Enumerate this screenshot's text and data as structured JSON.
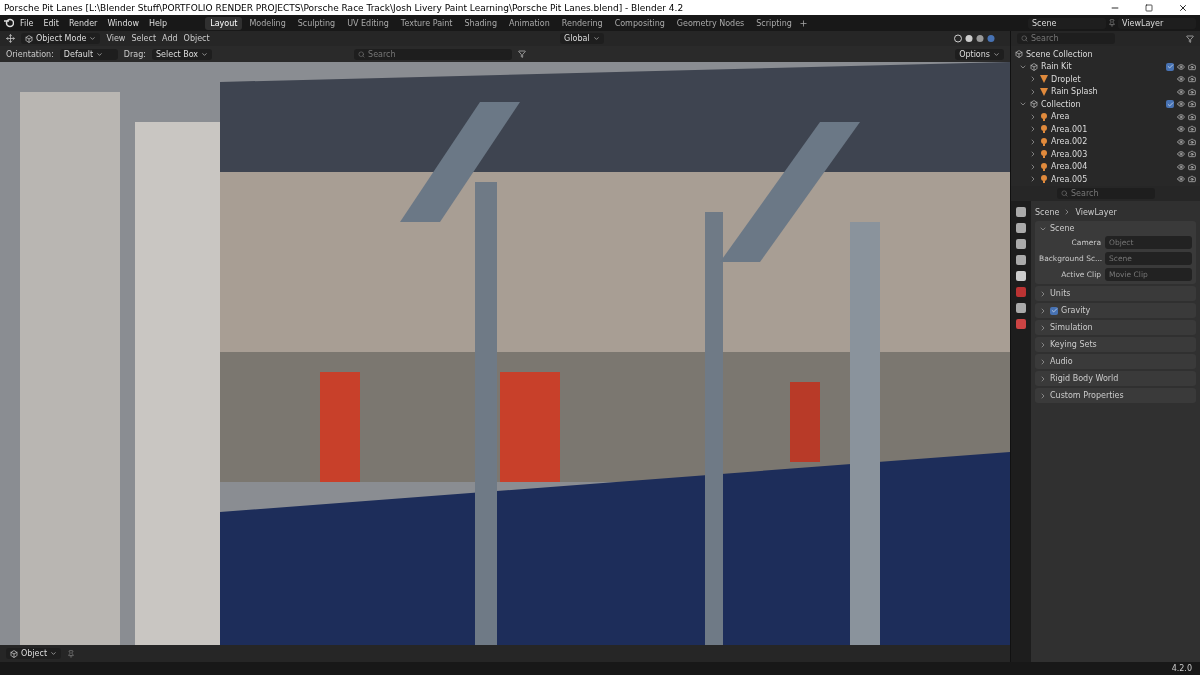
{
  "window": {
    "title": "Porsche Pit Lanes [L:\\Blender Stuff\\PORTFOLIO RENDER PROJECTS\\Porsche Race Track\\Josh Livery Paint Learning\\Porsche Pit Lanes.blend] - Blender 4.2"
  },
  "menu": [
    "File",
    "Edit",
    "Render",
    "Window",
    "Help"
  ],
  "workspaces": [
    {
      "label": "Layout",
      "selected": true
    },
    {
      "label": "Modeling",
      "selected": false
    },
    {
      "label": "Sculpting",
      "selected": false
    },
    {
      "label": "UV Editing",
      "selected": false
    },
    {
      "label": "Texture Paint",
      "selected": false
    },
    {
      "label": "Shading",
      "selected": false
    },
    {
      "label": "Animation",
      "selected": false
    },
    {
      "label": "Rendering",
      "selected": false
    },
    {
      "label": "Compositing",
      "selected": false
    },
    {
      "label": "Geometry Nodes",
      "selected": false
    },
    {
      "label": "Scripting",
      "selected": false
    }
  ],
  "scene": "Scene",
  "view_layer": "ViewLayer",
  "viewport_header": {
    "mode": "Object Mode",
    "menus": [
      "View",
      "Select",
      "Add",
      "Object"
    ],
    "transform": "Global"
  },
  "tool_header": {
    "orientation_label": "Orientation:",
    "orientation": "Default",
    "drag_label": "Drag:",
    "drag": "Select Box",
    "search_placeholder": "Search",
    "options": "Options"
  },
  "outliner": {
    "search_placeholder": "Search",
    "root": "Scene Collection",
    "items": [
      {
        "label": "Rain Kit",
        "expanded": true,
        "checked": true,
        "children": [
          {
            "label": "Droplet",
            "kind": "object",
            "expanded": false
          },
          {
            "label": "Rain Splash",
            "kind": "object",
            "expanded": false
          }
        ]
      },
      {
        "label": "Collection",
        "expanded": true,
        "checked": true,
        "children": [
          {
            "label": "Area",
            "kind": "light",
            "expanded": false
          },
          {
            "label": "Area.001",
            "kind": "light",
            "expanded": false
          },
          {
            "label": "Area.002",
            "kind": "light",
            "expanded": false
          },
          {
            "label": "Area.003",
            "kind": "light",
            "expanded": false
          },
          {
            "label": "Area.004",
            "kind": "light",
            "expanded": false
          },
          {
            "label": "Area.005",
            "kind": "light",
            "expanded": false
          }
        ]
      }
    ]
  },
  "properties": {
    "search_placeholder": "Search",
    "breadcrumb": [
      "Scene",
      "ViewLayer"
    ],
    "panels": [
      {
        "label": "Scene",
        "expanded": true,
        "fields": [
          {
            "label": "Camera",
            "placeholder": "Object"
          },
          {
            "label": "Background Sc...",
            "placeholder": "Scene"
          },
          {
            "label": "Active Clip",
            "placeholder": "Movie Clip"
          }
        ]
      },
      {
        "label": "Units",
        "expanded": false
      },
      {
        "label": "Gravity",
        "expanded": false,
        "checked": true
      },
      {
        "label": "Simulation",
        "expanded": false
      },
      {
        "label": "Keying Sets",
        "expanded": false
      },
      {
        "label": "Audio",
        "expanded": false
      },
      {
        "label": "Rigid Body World",
        "expanded": false
      },
      {
        "label": "Custom Properties",
        "expanded": false
      }
    ]
  },
  "timeline": {
    "mode": "Object"
  },
  "status_bar": {
    "version": "4.2.0"
  }
}
